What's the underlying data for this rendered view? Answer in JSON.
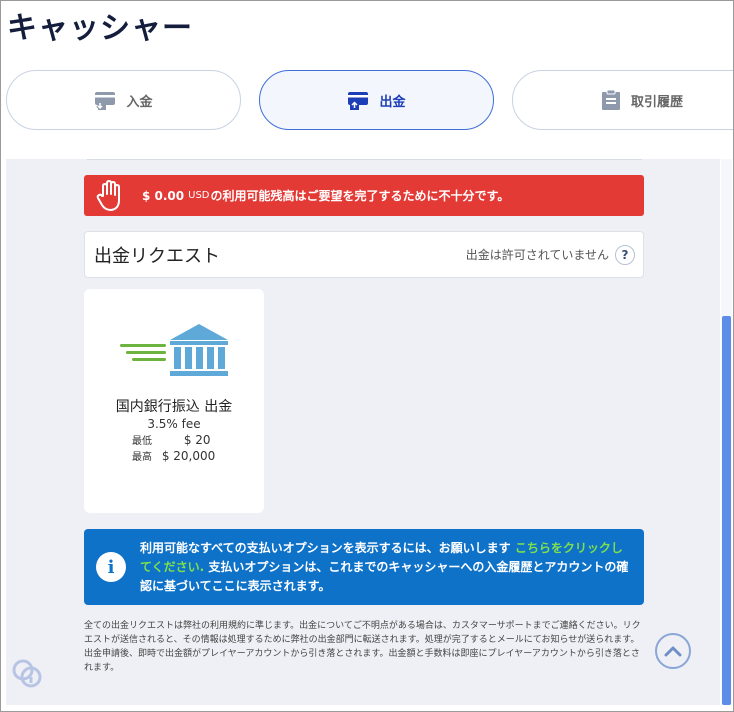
{
  "page": {
    "title": "キャッシャー"
  },
  "tabs": [
    {
      "label": "入金",
      "icon": "deposit-icon",
      "active": false
    },
    {
      "label": "出金",
      "icon": "withdraw-icon",
      "active": true
    },
    {
      "label": "取引履歴",
      "icon": "history-icon",
      "active": false
    }
  ],
  "alert": {
    "amount": "$ 0.00",
    "currency": "USD",
    "message": "の利用可能残高はご要望を完了するために不十分です。",
    "icon": "hand-stop-icon",
    "color": "#e33a36"
  },
  "request": {
    "title": "出金リクエスト",
    "status": "出金は許可されていません",
    "help": "?"
  },
  "method": {
    "name": "国内銀行振込 出金",
    "fee": "3.5% fee",
    "min_label": "最低",
    "min_value": "$ 20",
    "max_label": "最高",
    "max_value": "$ 20,000",
    "icon": "bank-icon"
  },
  "info": {
    "icon": "i",
    "text_before": "利用可能なすべての支払いオプションを表示するには、お願いします ",
    "link": "こちらをクリックしてください.",
    "text_after": " 支払いオプションは、これまでのキャッシャーへの入金履歴とアカウントの確認に基づいてここに表示されます。",
    "color": "#0f72c9",
    "link_color": "#7ee04b"
  },
  "disclaimer": "全ての出金リクエストは弊社の利用規約に準じます。出金についてご不明点がある場合は、カスタマーサポートまでご連絡ください。リクエストが送信されると、その情報は処理するために弊社の出金部門に転送されます。処理が完了するとメールにてお知らせが送られます。出金申請後、即時で出金額がプレイヤーアカウントから引き落とされます。出金額と手数料は即座にプレイヤーアカウントから引き落とされます。",
  "accent": "#3e6fd8"
}
